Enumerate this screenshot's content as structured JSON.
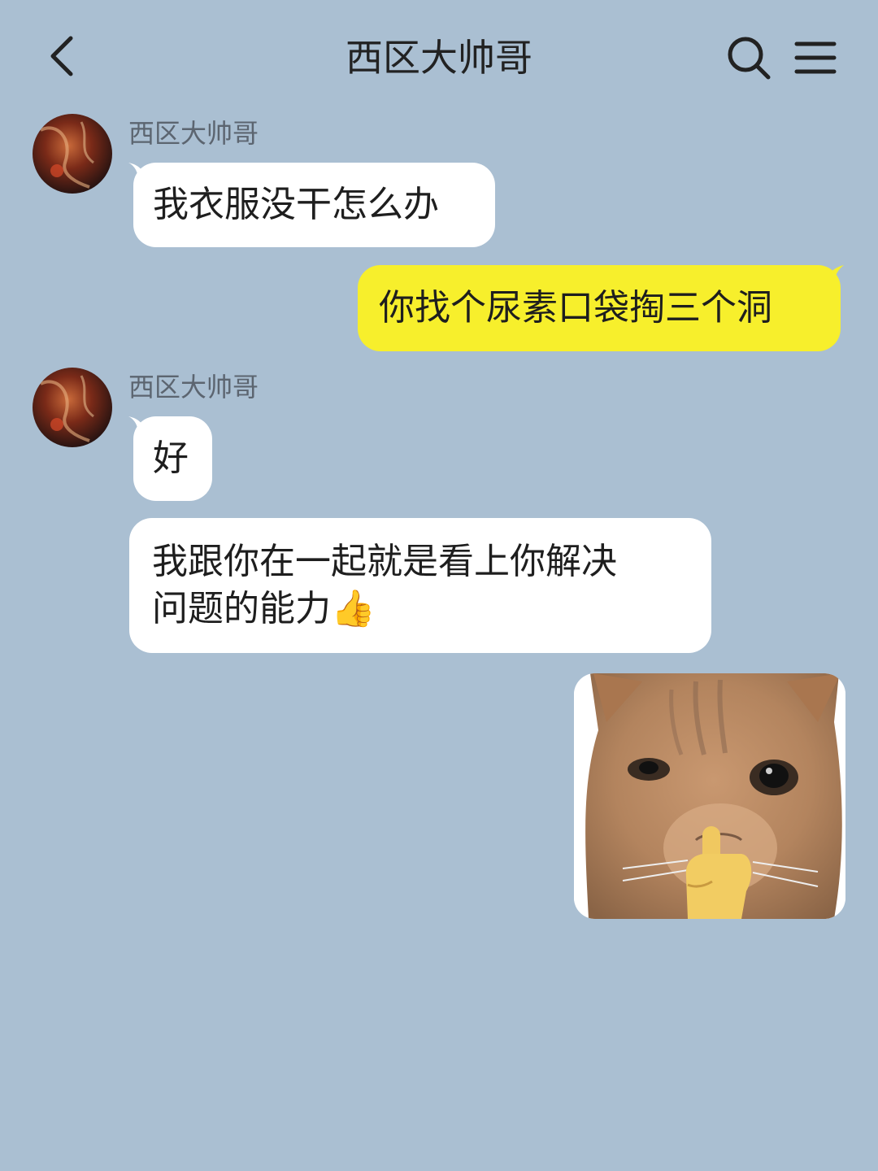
{
  "header": {
    "title": "西区大帅哥",
    "back_icon": "chevron-left-icon",
    "search_icon": "search-icon",
    "menu_icon": "menu-icon"
  },
  "messages": [
    {
      "sender": "西区大帅哥",
      "direction": "incoming",
      "text": "我衣服没干怎么办"
    },
    {
      "direction": "outgoing",
      "text": "你找个尿素口袋掏三个洞"
    },
    {
      "sender": "西区大帅哥",
      "direction": "incoming",
      "text": "好"
    },
    {
      "direction": "incoming",
      "line1": "我跟你在一起就是看上你解决",
      "line2": "问题的能力👍"
    },
    {
      "direction": "outgoing",
      "type": "image",
      "image": "cat-shush-sticker"
    }
  ],
  "colors": {
    "background": "#aabfd2",
    "incoming_bubble": "#ffffff",
    "outgoing_bubble": "#f7ef2c"
  }
}
